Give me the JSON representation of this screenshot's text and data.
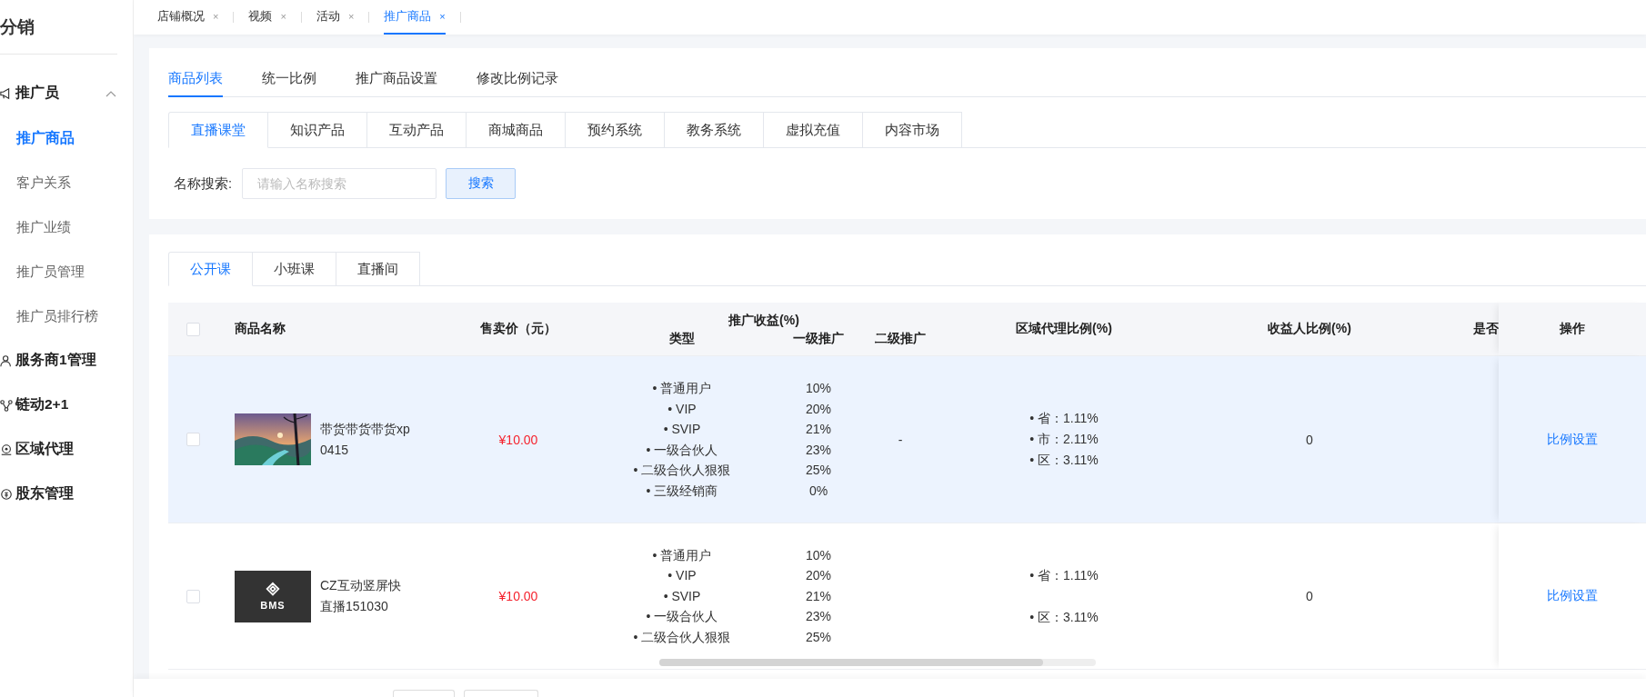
{
  "sidebar": {
    "title": "分销",
    "groups": [
      {
        "label": "推广员",
        "kind": "megaphone",
        "expanded": true,
        "children": [
          {
            "label": "推广商品",
            "selected": true
          },
          {
            "label": "客户关系",
            "selected": false
          },
          {
            "label": "推广业绩",
            "selected": false
          },
          {
            "label": "推广员管理",
            "selected": false
          },
          {
            "label": "推广员排行榜",
            "selected": false
          }
        ]
      },
      {
        "label": "服务商1管理",
        "kind": "user"
      },
      {
        "label": "链动2+1",
        "kind": "share"
      },
      {
        "label": "区域代理",
        "kind": "pin"
      },
      {
        "label": "股东管理",
        "kind": "coin"
      }
    ]
  },
  "top_tabs": [
    {
      "label": "店铺概况",
      "close": "×",
      "selected": false
    },
    {
      "label": "视频",
      "close": "×",
      "selected": false
    },
    {
      "label": "活动",
      "close": "×",
      "selected": false
    },
    {
      "label": "推广商品",
      "close": "×",
      "selected": true
    }
  ],
  "page_tabs": [
    {
      "label": "商品列表",
      "selected": true
    },
    {
      "label": "统一比例",
      "selected": false
    },
    {
      "label": "推广商品设置",
      "selected": false
    },
    {
      "label": "修改比例记录",
      "selected": false
    }
  ],
  "category_tabs": [
    {
      "label": "直播课堂",
      "selected": true
    },
    {
      "label": "知识产品",
      "selected": false
    },
    {
      "label": "互动产品",
      "selected": false
    },
    {
      "label": "商城商品",
      "selected": false
    },
    {
      "label": "预约系统",
      "selected": false
    },
    {
      "label": "教务系统",
      "selected": false
    },
    {
      "label": "虚拟充值",
      "selected": false
    },
    {
      "label": "内容市场",
      "selected": false
    }
  ],
  "search": {
    "label": "名称搜索:",
    "placeholder": "请输入名称搜索",
    "button": "搜索"
  },
  "course_tabs": [
    {
      "label": "公开课",
      "selected": true
    },
    {
      "label": "小班课",
      "selected": false
    },
    {
      "label": "直播间",
      "selected": false
    }
  ],
  "table": {
    "header_checked": false,
    "columns": {
      "name": "商品名称",
      "price": "售卖价（元）",
      "promotion": "推广收益(%)",
      "type": "类型",
      "level1": "一级推广",
      "level2": "二级推广",
      "region": "区域代理比例(%)",
      "beneficiary": "收益人比例(%)",
      "column_9": "是否",
      "action": "操作"
    },
    "rows": [
      {
        "checked": false,
        "highlighted": true,
        "thumbnail": {
          "kind": "landscape"
        },
        "name": "带货带货带货xp 0415",
        "price": "¥10.00",
        "promotion": [
          {
            "type": "• 普通用户",
            "level1": "10%"
          },
          {
            "type": "• VIP",
            "level1": "20%"
          },
          {
            "type": "• SVIP",
            "level1": "21%"
          },
          {
            "type": "• 一级合伙人",
            "level1": "23%"
          },
          {
            "type": "• 二级合伙人狠狠",
            "level1": "25%"
          },
          {
            "type": "• 三级经销商",
            "level1": "0%"
          }
        ],
        "level2": "-",
        "region": [
          "• 省：1.11%",
          "• 市：2.11%",
          "• 区：3.11%"
        ],
        "beneficiary": "0",
        "action": "比例设置"
      },
      {
        "checked": false,
        "highlighted": false,
        "thumbnail": {
          "kind": "logo",
          "text": "BMS"
        },
        "name": "CZ互动竖屏快直播151030",
        "price": "¥10.00",
        "promotion": [
          {
            "type": "• 普通用户",
            "level1": "10%"
          },
          {
            "type": "• VIP",
            "level1": "20%"
          },
          {
            "type": "• SVIP",
            "level1": "21%"
          },
          {
            "type": "• 一级合伙人",
            "level1": "23%"
          },
          {
            "type": "• 二级合伙人狠狠",
            "level1": "25%"
          }
        ],
        "region": [
          "• 省：1.11%",
          "• 区：3.11%"
        ],
        "beneficiary": "0",
        "action": "比例设置"
      }
    ]
  }
}
